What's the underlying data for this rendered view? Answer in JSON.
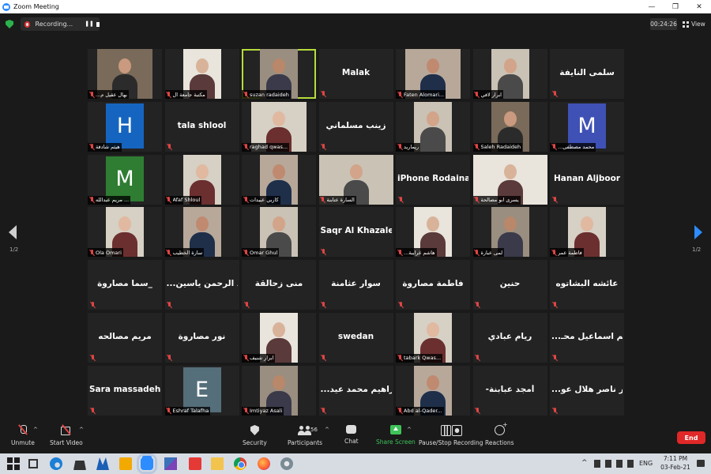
{
  "window": {
    "title": "Zoom Meeting",
    "controls": [
      "—",
      "❐",
      "✕"
    ]
  },
  "topbar": {
    "recording_label": "Recording...",
    "pause_glyph": "❚❚",
    "timer": "00:24:26",
    "view_label": "View"
  },
  "pager": {
    "left": "1/2",
    "right": "1/2"
  },
  "participants": [
    {
      "name": "...بهال عقيل م",
      "type": "photo"
    },
    {
      "name": "مكتبة جامعة ال",
      "type": "photo"
    },
    {
      "name": "suzan radaideh",
      "type": "photo",
      "active": true
    },
    {
      "name": "Malak",
      "type": "text"
    },
    {
      "name": "Faten Alomari...",
      "type": "photo"
    },
    {
      "name": "ابرار لافي",
      "type": "photo"
    },
    {
      "name": "سلمى النايفة",
      "type": "text"
    },
    {
      "name": "هيثم شادفة",
      "type": "avatar",
      "letter": "H",
      "color": "#1565c0"
    },
    {
      "name": "tala shlool",
      "type": "text"
    },
    {
      "name": "raghad qwas...",
      "type": "photo"
    },
    {
      "name": "زينب مسلماني",
      "type": "text"
    },
    {
      "name": "ريماريد",
      "type": "photo"
    },
    {
      "name": "Saleh Radaideh",
      "type": "photo"
    },
    {
      "name": "...محمد مصطفى",
      "type": "avatar",
      "letter": "M",
      "color": "#3f51b5"
    },
    {
      "name": "مريم عبدالله ...",
      "type": "avatar",
      "letter": "M",
      "color": "#2e7d32"
    },
    {
      "name": "Afaf Shloul",
      "type": "photo"
    },
    {
      "name": "كاربي عبيدات",
      "type": "photo"
    },
    {
      "name": "السارة عتابنة",
      "type": "photo"
    },
    {
      "name": "iPhone Rodainah",
      "type": "text"
    },
    {
      "name": "يسرى ابو مصالحة",
      "type": "photo"
    },
    {
      "name": "Hanan Aljboor",
      "type": "text"
    },
    {
      "name": "Ola Omari",
      "type": "photo"
    },
    {
      "name": "سارة الخطيب",
      "type": "photo"
    },
    {
      "name": "Omar Ghul",
      "type": "photo"
    },
    {
      "name": "Saqr Al Khazaleh",
      "type": "text"
    },
    {
      "name": "...هاشم غرايبة",
      "type": "photo"
    },
    {
      "name": "لمى عبارة",
      "type": "photo"
    },
    {
      "name": "فاطمة عمر",
      "type": "photo"
    },
    {
      "name": "سما مصاروة_",
      "type": "text"
    },
    {
      "name": "...عبد الرحمن ياسين",
      "type": "text"
    },
    {
      "name": "منى زحالقة",
      "type": "text"
    },
    {
      "name": "سوار عثامنة",
      "type": "text"
    },
    {
      "name": "فاطمة مصاروة",
      "type": "text"
    },
    {
      "name": "حنين",
      "type": "text"
    },
    {
      "name": "عائشه البشاتوه",
      "type": "text"
    },
    {
      "name": "مريم مصالحه",
      "type": "text"
    },
    {
      "name": "نور مصاروة",
      "type": "text"
    },
    {
      "name": "ابرار شنيف",
      "type": "photo"
    },
    {
      "name": "swedan",
      "type": "text"
    },
    {
      "name": "tabark Qwas...",
      "type": "photo"
    },
    {
      "name": "ريام عبادي",
      "type": "text"
    },
    {
      "name": "...مريم اسماعيل محـ",
      "type": "text"
    },
    {
      "name": "Sara massadeh",
      "type": "text"
    },
    {
      "name": "Eshraf Talafha",
      "type": "avatar",
      "letter": "E",
      "color": "#546e7a"
    },
    {
      "name": "Imtiyaz Asali",
      "type": "photo"
    },
    {
      "name": "...ابراهيم محمد عيد",
      "type": "text"
    },
    {
      "name": "Abd al-Qader...",
      "type": "photo"
    },
    {
      "name": "-أمجد عبابنة",
      "type": "text"
    },
    {
      "name": "...منار ناصر هلال عو",
      "type": "text"
    }
  ],
  "toolbar": {
    "unmute": "Unmute",
    "start_video": "Start Video",
    "security": "Security",
    "participants": "Participants",
    "participants_count": "56",
    "chat": "Chat",
    "share_screen": "Share Screen",
    "pause_stop": "Pause/Stop Recording",
    "reactions": "Reactions",
    "end": "End",
    "caret": "^"
  },
  "taskbar": {
    "lang": "ENG",
    "time": "7:11 PM",
    "date": "03-Feb-21",
    "tray_caret": "^"
  },
  "colors": {
    "active_speaker": "#b4dc3c",
    "share_green": "#3ec259",
    "end_red": "#e02828",
    "arrow_blue": "#2d8cff"
  }
}
